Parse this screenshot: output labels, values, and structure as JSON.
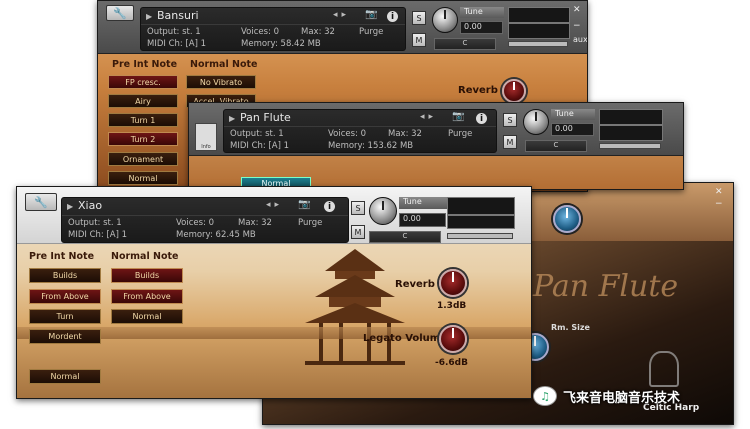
{
  "bansuri": {
    "name": "Bansuri",
    "output_label": "Output:",
    "output_value": "st. 1",
    "voices_label": "Voices:",
    "voices_value": "0",
    "max_label": "Max:",
    "max_value": "32",
    "purge_label": "Purge",
    "midi_label": "MIDI Ch:",
    "midi_value": "[A] 1",
    "memory_label": "Memory:",
    "memory_value": "58.42 MB",
    "tune_label": "Tune",
    "tune_value": "0.00",
    "pan_label": "C",
    "pre_int_title": "Pre Int Note",
    "normal_note_title": "Normal Note",
    "pre_int_buttons": [
      "FP cresc.",
      "Airy",
      "Turn 1",
      "Turn 2",
      "Ornament",
      "Normal"
    ],
    "normal_note_buttons": [
      "No Vibrato",
      "Accel. Vibrato"
    ],
    "reverb_label": "Reverb"
  },
  "panflute": {
    "name": "Pan Flute",
    "output_label": "Output:",
    "output_value": "st. 1",
    "voices_label": "Voices:",
    "voices_value": "0",
    "max_label": "Max:",
    "max_value": "32",
    "purge_label": "Purge",
    "midi_label": "MIDI Ch:",
    "midi_value": "[A] 1",
    "memory_label": "Memory:",
    "memory_value": "153.62 MB",
    "tune_label": "Tune",
    "tune_value": "0.00",
    "pan_label": "C",
    "normal_button": "Normal",
    "thumb_label": "Info"
  },
  "xiao": {
    "name": "Xiao",
    "output_label": "Output:",
    "output_value": "st. 1",
    "voices_label": "Voices:",
    "voices_value": "0",
    "max_label": "Max:",
    "max_value": "32",
    "purge_label": "Purge",
    "midi_label": "MIDI Ch:",
    "midi_value": "[A] 1",
    "memory_label": "Memory:",
    "memory_value": "62.45 MB",
    "tune_label": "Tune",
    "tune_value": "0.00",
    "pan_label": "C",
    "pre_int_title": "Pre Int Note",
    "normal_note_title": "Normal Note",
    "pre_int_buttons": [
      "Builds",
      "From Above",
      "Turn",
      "Mordent"
    ],
    "normal_bottom": "Normal",
    "normal_note_buttons": [
      "Builds",
      "From Above",
      "Normal"
    ],
    "reverb_label": "Reverb",
    "reverb_value": "1.3dB",
    "legato_label": "Legato Volume",
    "legato_value": "-6.6dB"
  },
  "celtic": {
    "script_title": "Pan Flute",
    "rm_size_label": "Rm. Size",
    "brand": "Celtic Harp"
  },
  "watermark": {
    "logo": "♫",
    "text": "飞来音电脑音乐技术"
  },
  "colors": {
    "accent_button": "#3a0707",
    "label_text": "#2a1005",
    "header_bg": "#5a5a5a"
  }
}
